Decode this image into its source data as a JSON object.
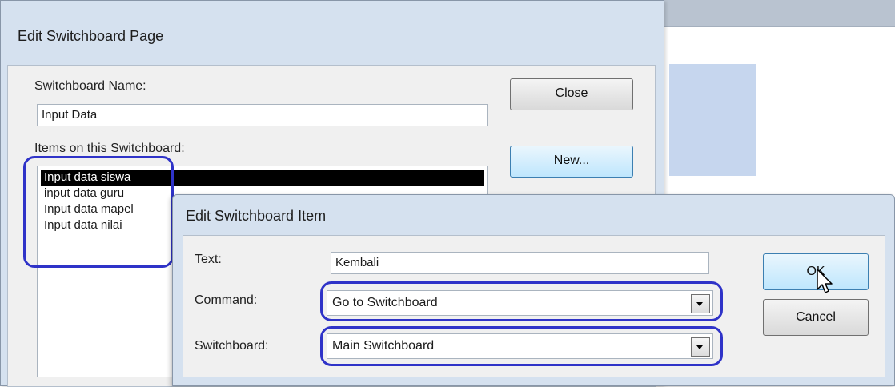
{
  "switchboard_page": {
    "title": "Edit Switchboard Page",
    "name_label": "Switchboard Name:",
    "name_value": "Input Data",
    "items_label": "Items on this Switchboard:",
    "items": [
      {
        "label": "Input data siswa",
        "selected": true
      },
      {
        "label": "input data guru",
        "selected": false
      },
      {
        "label": "Input data mapel",
        "selected": false
      },
      {
        "label": "Input data nilai",
        "selected": false
      }
    ],
    "close_button": "Close",
    "new_button": "New..."
  },
  "switchboard_item": {
    "title": "Edit Switchboard Item",
    "text_label": "Text:",
    "text_value": "Kembali",
    "command_label": "Command:",
    "command_value": "Go to Switchboard",
    "switchboard_label": "Switchboard:",
    "switchboard_value": "Main Switchboard",
    "ok_button": "OK",
    "cancel_button": "Cancel"
  },
  "colors": {
    "highlight": "#2f33c8",
    "dialog_frame": "#d5e1ef",
    "selection": "#000000"
  }
}
